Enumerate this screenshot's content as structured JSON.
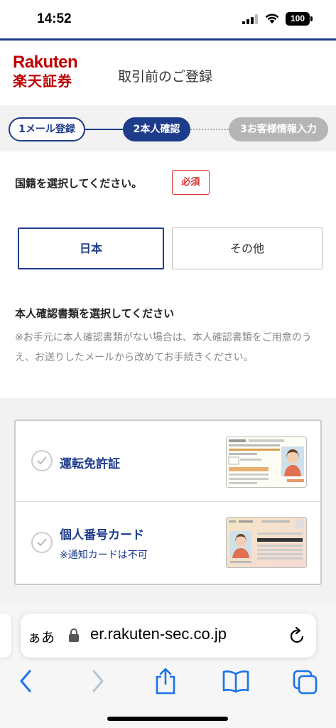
{
  "status_bar": {
    "time": "14:52",
    "battery": "100"
  },
  "header": {
    "logo_en": "Rakuten",
    "logo_jp": "楽天証券",
    "title": "取引前のご登録"
  },
  "stepper": {
    "steps": [
      {
        "label": "1メール登録",
        "state": "done"
      },
      {
        "label": "2本人確認",
        "state": "current"
      },
      {
        "label": "3お客様情報入力",
        "state": "upcoming"
      }
    ]
  },
  "nationality": {
    "question": "国籍を選択してください。",
    "required_badge": "必須",
    "options": [
      {
        "label": "日本",
        "selected": true
      },
      {
        "label": "その他",
        "selected": false
      }
    ]
  },
  "id_documents": {
    "question": "本人確認書類を選択してください",
    "note": "※お手元に本人確認書類がない場合は、本人確認書類をご用意のうえ、お送りしたメールから改めてお手続きください。",
    "items": [
      {
        "label": "運転免許証",
        "sub": "",
        "icon": "drivers-license-image"
      },
      {
        "label": "個人番号カード",
        "sub": "※通知カードは不可",
        "icon": "my-number-card-image"
      }
    ]
  },
  "browser": {
    "aa_label": "ぁあ",
    "url": "er.rakuten-sec.co.jp"
  },
  "colors": {
    "brand_red": "#bf0000",
    "navy": "#1e3c8c",
    "required_red": "#dd3333",
    "ios_blue": "#1a73e8"
  }
}
